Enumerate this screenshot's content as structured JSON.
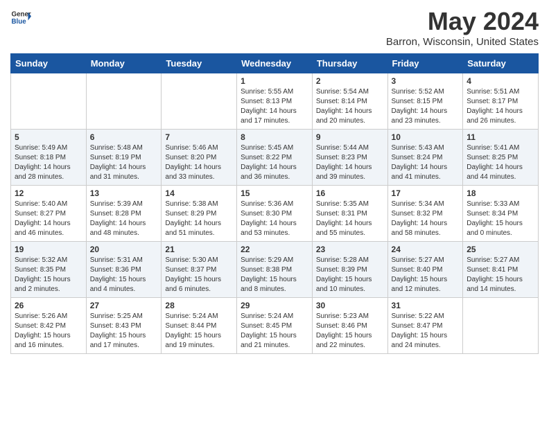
{
  "header": {
    "logo_general": "General",
    "logo_blue": "Blue",
    "title": "May 2024",
    "subtitle": "Barron, Wisconsin, United States"
  },
  "days_of_week": [
    "Sunday",
    "Monday",
    "Tuesday",
    "Wednesday",
    "Thursday",
    "Friday",
    "Saturday"
  ],
  "weeks": [
    [
      {
        "day": "",
        "info": ""
      },
      {
        "day": "",
        "info": ""
      },
      {
        "day": "",
        "info": ""
      },
      {
        "day": "1",
        "info": "Sunrise: 5:55 AM\nSunset: 8:13 PM\nDaylight: 14 hours\nand 17 minutes."
      },
      {
        "day": "2",
        "info": "Sunrise: 5:54 AM\nSunset: 8:14 PM\nDaylight: 14 hours\nand 20 minutes."
      },
      {
        "day": "3",
        "info": "Sunrise: 5:52 AM\nSunset: 8:15 PM\nDaylight: 14 hours\nand 23 minutes."
      },
      {
        "day": "4",
        "info": "Sunrise: 5:51 AM\nSunset: 8:17 PM\nDaylight: 14 hours\nand 26 minutes."
      }
    ],
    [
      {
        "day": "5",
        "info": "Sunrise: 5:49 AM\nSunset: 8:18 PM\nDaylight: 14 hours\nand 28 minutes."
      },
      {
        "day": "6",
        "info": "Sunrise: 5:48 AM\nSunset: 8:19 PM\nDaylight: 14 hours\nand 31 minutes."
      },
      {
        "day": "7",
        "info": "Sunrise: 5:46 AM\nSunset: 8:20 PM\nDaylight: 14 hours\nand 33 minutes."
      },
      {
        "day": "8",
        "info": "Sunrise: 5:45 AM\nSunset: 8:22 PM\nDaylight: 14 hours\nand 36 minutes."
      },
      {
        "day": "9",
        "info": "Sunrise: 5:44 AM\nSunset: 8:23 PM\nDaylight: 14 hours\nand 39 minutes."
      },
      {
        "day": "10",
        "info": "Sunrise: 5:43 AM\nSunset: 8:24 PM\nDaylight: 14 hours\nand 41 minutes."
      },
      {
        "day": "11",
        "info": "Sunrise: 5:41 AM\nSunset: 8:25 PM\nDaylight: 14 hours\nand 44 minutes."
      }
    ],
    [
      {
        "day": "12",
        "info": "Sunrise: 5:40 AM\nSunset: 8:27 PM\nDaylight: 14 hours\nand 46 minutes."
      },
      {
        "day": "13",
        "info": "Sunrise: 5:39 AM\nSunset: 8:28 PM\nDaylight: 14 hours\nand 48 minutes."
      },
      {
        "day": "14",
        "info": "Sunrise: 5:38 AM\nSunset: 8:29 PM\nDaylight: 14 hours\nand 51 minutes."
      },
      {
        "day": "15",
        "info": "Sunrise: 5:36 AM\nSunset: 8:30 PM\nDaylight: 14 hours\nand 53 minutes."
      },
      {
        "day": "16",
        "info": "Sunrise: 5:35 AM\nSunset: 8:31 PM\nDaylight: 14 hours\nand 55 minutes."
      },
      {
        "day": "17",
        "info": "Sunrise: 5:34 AM\nSunset: 8:32 PM\nDaylight: 14 hours\nand 58 minutes."
      },
      {
        "day": "18",
        "info": "Sunrise: 5:33 AM\nSunset: 8:34 PM\nDaylight: 15 hours\nand 0 minutes."
      }
    ],
    [
      {
        "day": "19",
        "info": "Sunrise: 5:32 AM\nSunset: 8:35 PM\nDaylight: 15 hours\nand 2 minutes."
      },
      {
        "day": "20",
        "info": "Sunrise: 5:31 AM\nSunset: 8:36 PM\nDaylight: 15 hours\nand 4 minutes."
      },
      {
        "day": "21",
        "info": "Sunrise: 5:30 AM\nSunset: 8:37 PM\nDaylight: 15 hours\nand 6 minutes."
      },
      {
        "day": "22",
        "info": "Sunrise: 5:29 AM\nSunset: 8:38 PM\nDaylight: 15 hours\nand 8 minutes."
      },
      {
        "day": "23",
        "info": "Sunrise: 5:28 AM\nSunset: 8:39 PM\nDaylight: 15 hours\nand 10 minutes."
      },
      {
        "day": "24",
        "info": "Sunrise: 5:27 AM\nSunset: 8:40 PM\nDaylight: 15 hours\nand 12 minutes."
      },
      {
        "day": "25",
        "info": "Sunrise: 5:27 AM\nSunset: 8:41 PM\nDaylight: 15 hours\nand 14 minutes."
      }
    ],
    [
      {
        "day": "26",
        "info": "Sunrise: 5:26 AM\nSunset: 8:42 PM\nDaylight: 15 hours\nand 16 minutes."
      },
      {
        "day": "27",
        "info": "Sunrise: 5:25 AM\nSunset: 8:43 PM\nDaylight: 15 hours\nand 17 minutes."
      },
      {
        "day": "28",
        "info": "Sunrise: 5:24 AM\nSunset: 8:44 PM\nDaylight: 15 hours\nand 19 minutes."
      },
      {
        "day": "29",
        "info": "Sunrise: 5:24 AM\nSunset: 8:45 PM\nDaylight: 15 hours\nand 21 minutes."
      },
      {
        "day": "30",
        "info": "Sunrise: 5:23 AM\nSunset: 8:46 PM\nDaylight: 15 hours\nand 22 minutes."
      },
      {
        "day": "31",
        "info": "Sunrise: 5:22 AM\nSunset: 8:47 PM\nDaylight: 15 hours\nand 24 minutes."
      },
      {
        "day": "",
        "info": ""
      }
    ]
  ]
}
